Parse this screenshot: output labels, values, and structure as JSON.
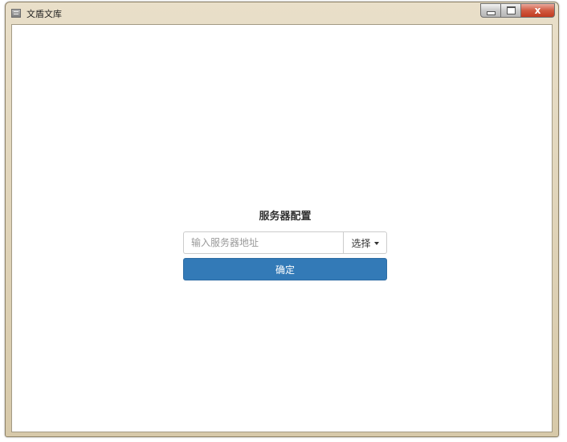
{
  "window": {
    "title": "文盾文库",
    "close_glyph": "x"
  },
  "icons": {
    "app": "app-icon",
    "minimize": "minimize-icon",
    "maximize": "maximize-icon",
    "close": "close-icon",
    "caret": "caret-down-icon"
  },
  "server_config": {
    "title": "服务器配置",
    "input_value": "",
    "input_placeholder": "输入服务器地址",
    "select_label": "选择",
    "confirm_label": "确定"
  },
  "colors": {
    "primary": "#337ab7",
    "close": "#c23b20"
  }
}
